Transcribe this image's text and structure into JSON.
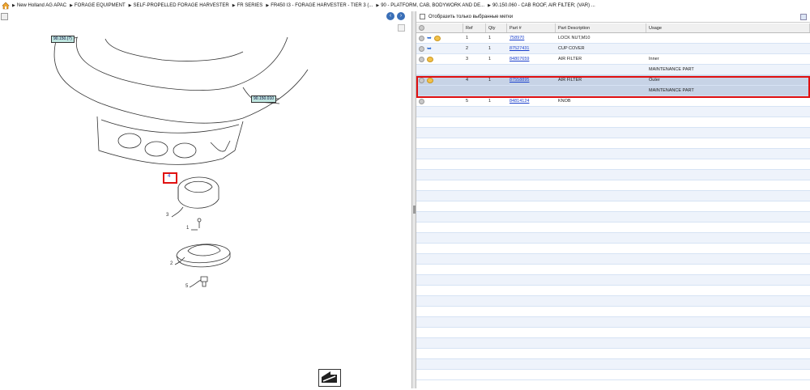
{
  "breadcrumb": [
    {
      "label": "New Holland AG APAC"
    },
    {
      "label": "FORAGE EQUIPMENT"
    },
    {
      "label": "SELF-PROPELLED FORAGE HARVESTER"
    },
    {
      "label": "FR SERIES"
    },
    {
      "label": "FR450 I3 - FORAGE HARVESTER - TIER 3 (..."
    },
    {
      "label": "90 - PLATFORM, CAB, BODYWORK AND DE..."
    },
    {
      "label": "90.150.060 - CAB ROOF, AIR FILTER; (VAR) ..."
    }
  ],
  "drawing": {
    "labels": {
      "top_box": "90.150.(?)",
      "side_box": "90.150.010",
      "ref4": "4"
    },
    "callouts": [
      "3",
      "1",
      "2",
      "5"
    ]
  },
  "filter": {
    "label": "Отобразить только выбранные метки"
  },
  "table": {
    "headers": {
      "ref": "Ref",
      "qty": "Qty",
      "part": "Part #",
      "desc": "Part Description",
      "usage": "Usage"
    },
    "rows": [
      {
        "ref": "1",
        "qty": "1",
        "part": "758970",
        "desc": "LOCK NUT,M10",
        "usage": "",
        "icons": [
          "plus",
          "arrow",
          "wrench"
        ]
      },
      {
        "ref": "2",
        "qty": "1",
        "part": "87527431",
        "desc": "CUP COVER",
        "usage": "",
        "icons": [
          "plus",
          "arrow"
        ]
      },
      {
        "ref": "3",
        "qty": "1",
        "part": "84807659",
        "desc": "AIR FILTER",
        "usage": "Inner",
        "icons": [
          "plus",
          "wrench"
        ]
      },
      {
        "ref": "",
        "qty": "",
        "part": "",
        "desc": "",
        "usage": "MAINTENANCE PART",
        "icons": []
      },
      {
        "ref": "4",
        "qty": "1",
        "part": "87558895",
        "desc": "AIR FILTER",
        "usage": "Outer",
        "icons": [
          "plus",
          "wrench"
        ]
      },
      {
        "ref": "",
        "qty": "",
        "part": "",
        "desc": "",
        "usage": "MAINTENANCE PART",
        "icons": []
      },
      {
        "ref": "5",
        "qty": "1",
        "part": "84814124",
        "desc": "KNOB",
        "usage": "",
        "icons": [
          "plus"
        ]
      }
    ],
    "selected_ref": "4"
  }
}
